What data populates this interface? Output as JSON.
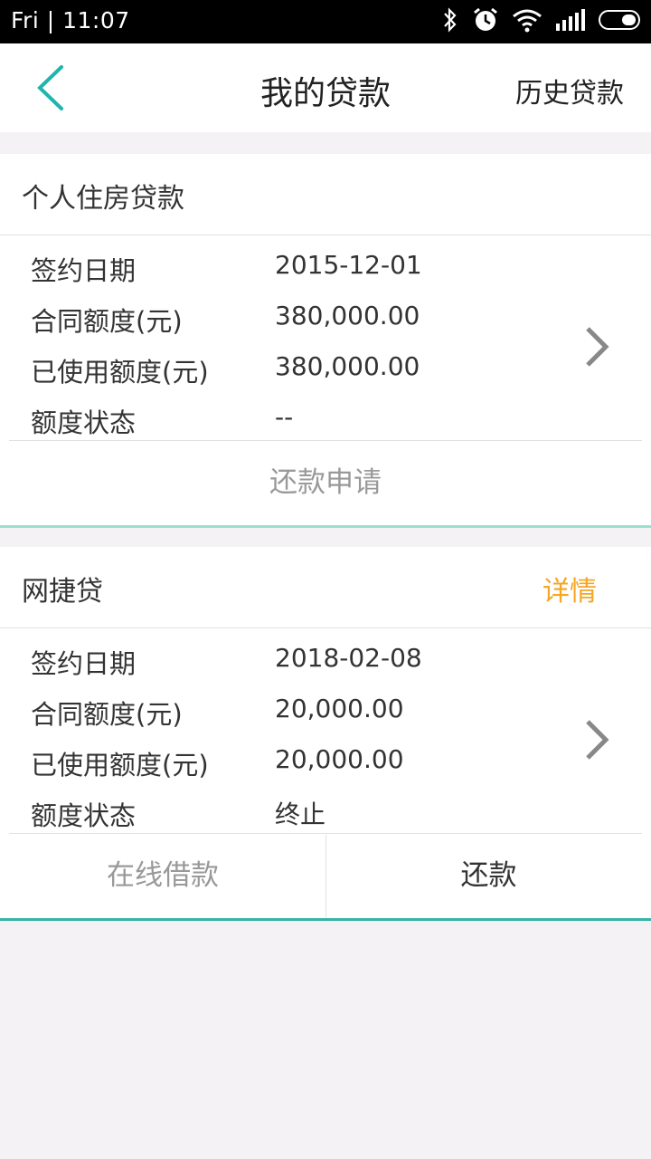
{
  "status_bar": {
    "time": "Fri | 11:07"
  },
  "header": {
    "title": "我的贷款",
    "history_label": "历史贷款"
  },
  "loans": [
    {
      "title": "个人住房贷款",
      "rows": [
        {
          "label": "签约日期",
          "value": "2015-12-01"
        },
        {
          "label": "合同额度(元)",
          "value": "380,000.00"
        },
        {
          "label": "已使用额度(元)",
          "value": "380,000.00"
        },
        {
          "label": "额度状态",
          "value": "--"
        }
      ],
      "action": "还款申请"
    },
    {
      "title": "网捷贷",
      "detail_label": "详情",
      "rows": [
        {
          "label": "签约日期",
          "value": "2018-02-08"
        },
        {
          "label": "合同额度(元)",
          "value": "20,000.00"
        },
        {
          "label": "已使用额度(元)",
          "value": "20,000.00"
        },
        {
          "label": "额度状态",
          "value": "终止"
        }
      ],
      "actions": [
        "在线借款",
        "还款"
      ]
    }
  ],
  "colors": {
    "accent": "#1fb5ad",
    "detail": "#f5a623",
    "muted": "#999999"
  }
}
